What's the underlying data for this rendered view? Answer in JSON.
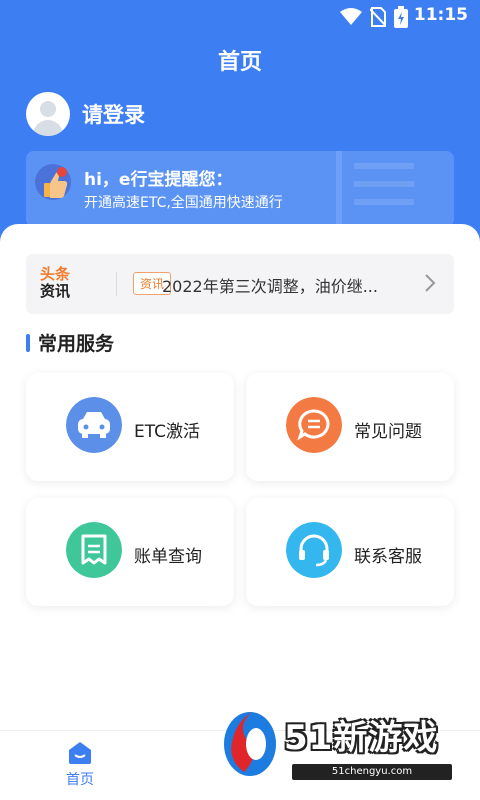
{
  "status_bar": {
    "time": "11:15"
  },
  "header": {
    "title": "首页"
  },
  "user": {
    "login_label": "请登录"
  },
  "banner": {
    "heading": "hi，e行宝提醒您：",
    "subtext": "开通高速ETC,全国通用快速通行"
  },
  "news": {
    "brand_top": "头条",
    "brand_bottom": "资讯",
    "tag": "资讯",
    "headline": "2022年第三次调整，油价继..."
  },
  "section": {
    "title": "常用服务"
  },
  "services": [
    {
      "label": "ETC激活",
      "icon": "car-icon",
      "color": "#5b8fe8"
    },
    {
      "label": "常见问题",
      "icon": "chat-icon",
      "color": "#f47a43"
    },
    {
      "label": "账单查询",
      "icon": "bill-icon",
      "color": "#3fc79a"
    },
    {
      "label": "联系客服",
      "icon": "headset-icon",
      "color": "#34b6ee"
    }
  ],
  "tabbar": {
    "home_label": "首页"
  },
  "watermark": {
    "text": "51新游戏",
    "url": "51chengyu.com"
  },
  "colors": {
    "primary": "#3d7ef3",
    "accent": "#f07c2e"
  }
}
